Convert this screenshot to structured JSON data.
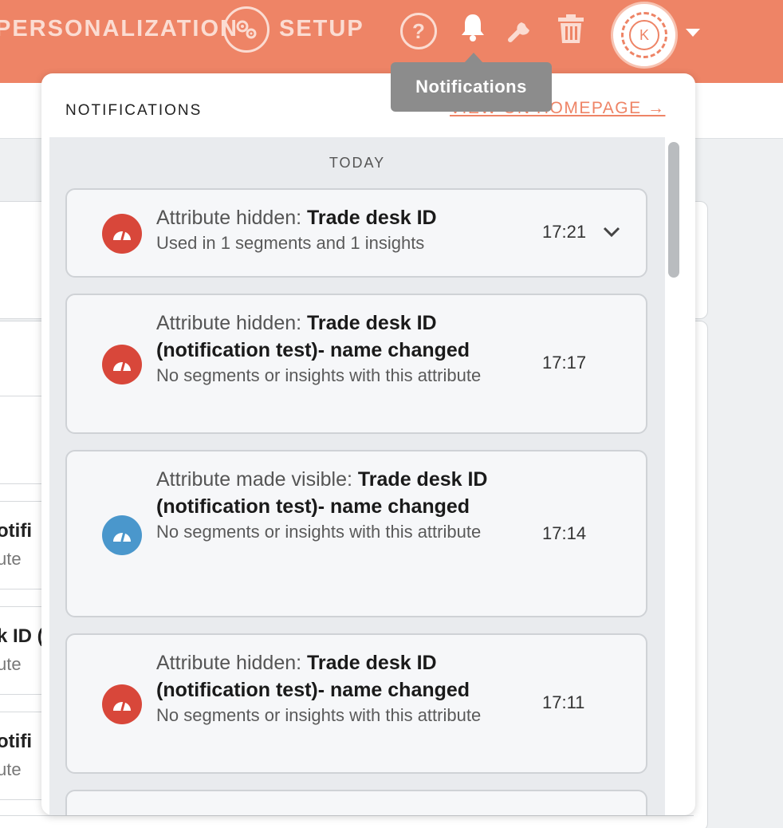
{
  "topbar": {
    "personalization_label": "PERSONALIZATION",
    "setup_label": "SETUP",
    "help_symbol": "?",
    "avatar_initial": "K",
    "icons": [
      "settings-gears-icon",
      "help-icon",
      "bell-icon",
      "wrench-icon",
      "trash-icon",
      "chevron-down-icon"
    ]
  },
  "tooltip": {
    "text": "Notifications"
  },
  "background": {
    "rows": [
      {
        "title": "otifi",
        "sub": "ute"
      },
      {
        "title": "k ID (",
        "sub": "ute"
      },
      {
        "title": "otifi",
        "sub": "ute"
      }
    ],
    "last_sub": "ute"
  },
  "panel": {
    "title": "NOTIFICATIONS",
    "homepage_link": "VIEW ON HOMEPAGE →",
    "day_label": "TODAY",
    "notifications": [
      {
        "pre": "Attribute hidden: ",
        "name": "Trade desk ID",
        "sub": "Used in 1 segments and 1 insights",
        "time": "17:21",
        "status": "hidden",
        "color": "#d8473a"
      },
      {
        "pre": "Attribute hidden: ",
        "name": "Trade desk ID (notification test)- name changed",
        "sub": "No segments or insights with this attribute",
        "time": "17:17",
        "status": "hidden",
        "color": "#d8473a"
      },
      {
        "pre": "Attribute made visible: ",
        "name": "Trade desk ID (notification test)- name changed",
        "sub": "No segments or insights with this attribute",
        "time": "17:14",
        "status": "visible",
        "color": "#4a97cc"
      },
      {
        "pre": "Attribute hidden: ",
        "name": "Trade desk ID (notification test)- name changed",
        "sub": "No segments or insights with this attribute",
        "time": "17:11",
        "status": "hidden",
        "color": "#d8473a"
      }
    ]
  },
  "colors": {
    "brand": "#ee8466",
    "hidden": "#d8473a",
    "visible": "#4a97cc",
    "tooltip": "#8c8c8c"
  }
}
